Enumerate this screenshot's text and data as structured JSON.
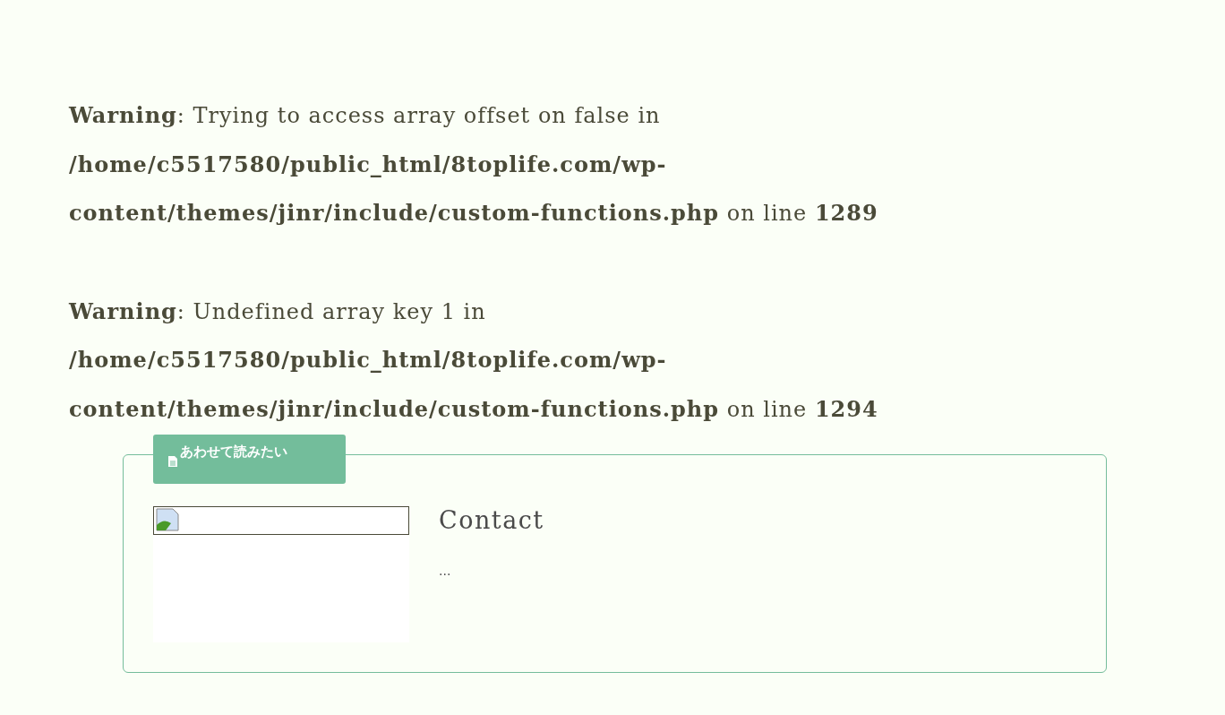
{
  "warnings": [
    {
      "text": "**Warning**: Trying to access array offset on false in **/home/c5517580/public_html/8toplife.com/wp-content/themes/jinr/include/custom-functions.php** on line **1289**"
    },
    {
      "text": "**Warning**: Undefined array key 1 in **/home/c5517580/public_html/8toplife.com/wp-content/themes/jinr/include/custom-functions.php** on line **1294**"
    }
  ],
  "related_box": {
    "label": "あわせて読みたい",
    "article": {
      "title": "Contact",
      "excerpt": "..."
    }
  }
}
